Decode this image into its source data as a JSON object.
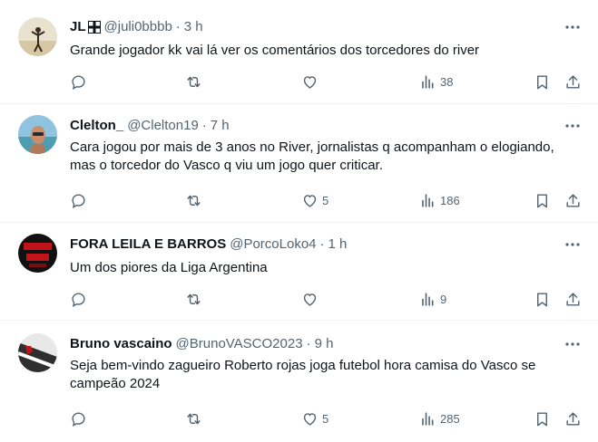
{
  "colors": {
    "muted": "#536471",
    "text": "#0f1419",
    "divider": "#eff3f4"
  },
  "tweets": [
    {
      "name": "JL",
      "has_badge": true,
      "handle": "@juli0bbbb",
      "separator": "·",
      "time": "3 h",
      "text": "Grande jogador kk vai lá ver os comentários dos torcedores do river",
      "likes": "",
      "views": "38",
      "avatar": "man-on-beach-avatar"
    },
    {
      "name": "Clelton_",
      "has_badge": false,
      "handle": "@Clelton19",
      "separator": "·",
      "time": "7 h",
      "text": "Cara jogou por mais de 3 anos no River, jornalistas q acompanham o elogiando, mas o torcedor do Vasco q viu um jogo quer criticar.",
      "likes": "5",
      "views": "186",
      "avatar": "man-selfie-avatar"
    },
    {
      "name": "FORA LEILA E BARROS",
      "has_badge": false,
      "handle": "@PorcoLoko4",
      "separator": "·",
      "time": "1 h",
      "text": "Um dos piores da Liga Argentina",
      "likes": "",
      "views": "9",
      "avatar": "red-text-avatar"
    },
    {
      "name": "Bruno vascaino",
      "has_badge": false,
      "handle": "@BrunoVASCO2023",
      "separator": "·",
      "time": "9 h",
      "text": "Seja bem-vindo zagueiro Roberto rojas joga futebol hora camisa do Vasco se campeão 2024",
      "likes": "5",
      "views": "285",
      "avatar": "vasco-flag-avatar"
    }
  ]
}
